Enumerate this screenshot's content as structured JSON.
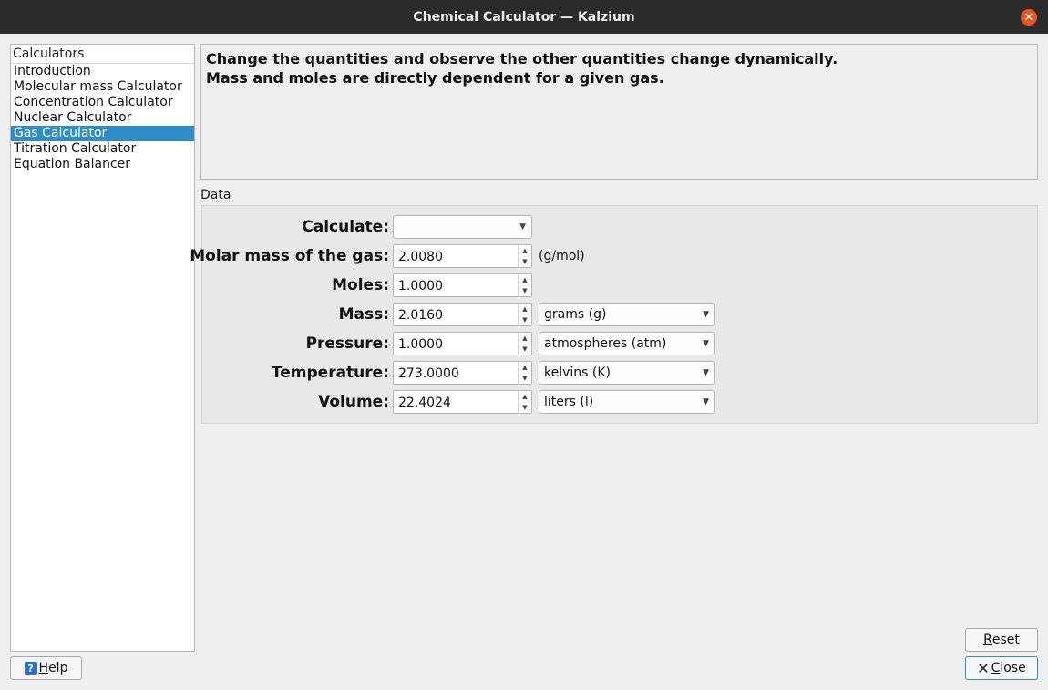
{
  "window": {
    "title": "Chemical Calculator — Kalzium"
  },
  "sidebar": {
    "header": "Calculators",
    "items": [
      {
        "label": "Introduction"
      },
      {
        "label": "Molecular mass Calculator"
      },
      {
        "label": "Concentration Calculator"
      },
      {
        "label": "Nuclear Calculator"
      },
      {
        "label": "Gas Calculator",
        "selected": true
      },
      {
        "label": "Titration Calculator"
      },
      {
        "label": "Equation Balancer"
      }
    ]
  },
  "description": {
    "line1": "Change the quantities and observe the other quantities change dynamically.",
    "line2": "Mass and moles are directly dependent for a given gas."
  },
  "data": {
    "group_label": "Data",
    "calculate": {
      "label": "Calculate:",
      "value": ""
    },
    "molar_mass": {
      "label": "Molar mass of the gas:",
      "value": "2.0080",
      "unit": "(g/mol)"
    },
    "moles": {
      "label": "Moles:",
      "value": "1.0000"
    },
    "mass": {
      "label": "Mass:",
      "value": "2.0160",
      "unit": "grams (g)"
    },
    "pressure": {
      "label": "Pressure:",
      "value": "1.0000",
      "unit": "atmospheres (atm)"
    },
    "temperature": {
      "label": "Temperature:",
      "value": "273.0000",
      "unit": "kelvins (K)"
    },
    "volume": {
      "label": "Volume:",
      "value": "22.4024",
      "unit": "liters (l)"
    }
  },
  "buttons": {
    "help_label_u": "H",
    "help_label_rest": "elp",
    "reset_label_u": "R",
    "reset_label_rest": "eset",
    "close_label_u": "C",
    "close_label_rest": "lose"
  },
  "colors": {
    "selection": "#308cc6",
    "close_accent": "#e95420",
    "titlebar": "#2b2b2b"
  }
}
